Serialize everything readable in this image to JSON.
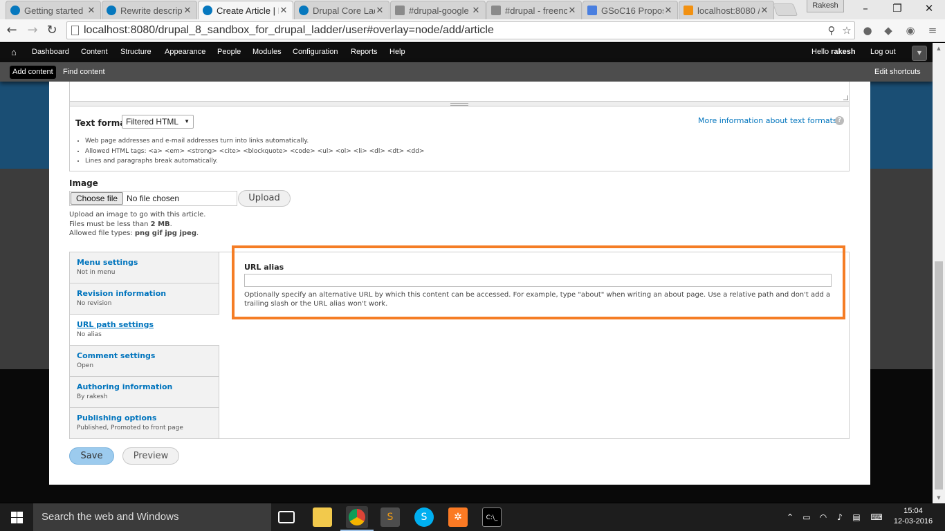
{
  "browser": {
    "tabs": [
      {
        "title": "Getting started",
        "favicon": "drupal-drop-icon"
      },
      {
        "title": "Rewrite descript",
        "favicon": "drupal-drop-icon"
      },
      {
        "title": "Create Article | I",
        "favicon": "drupal-drop-icon",
        "active": true
      },
      {
        "title": "Drupal Core Lad",
        "favicon": "drupal-drop-icon"
      },
      {
        "title": "#drupal-google",
        "favicon": "irc-icon"
      },
      {
        "title": "#drupal - freenc",
        "favicon": "irc-icon"
      },
      {
        "title": "GSoC16 Propos",
        "favicon": "google-docs-icon"
      },
      {
        "title": "localhost:8080 /",
        "favicon": "phpmyadmin-icon"
      }
    ],
    "profile_name": "Rakesh",
    "url": "localhost:8080/drupal_8_sandbox_for_drupal_ladder/user#overlay=node/add/article"
  },
  "admin_toolbar": {
    "menu": [
      "Dashboard",
      "Content",
      "Structure",
      "Appearance",
      "People",
      "Modules",
      "Configuration",
      "Reports",
      "Help"
    ],
    "greeting": "Hello ",
    "username": "rakesh",
    "logout": "Log out",
    "shortcuts": {
      "add_content": "Add content",
      "find_content": "Find content",
      "edit_shortcuts": "Edit shortcuts"
    }
  },
  "text_format": {
    "label": "Text format",
    "selected": "Filtered HTML",
    "more_info": "More information about text formats",
    "help_icon": "?",
    "tips": [
      "Web page addresses and e-mail addresses turn into links automatically.",
      "Allowed HTML tags: <a> <em> <strong> <cite> <blockquote> <code> <ul> <ol> <li> <dl> <dt> <dd>",
      "Lines and paragraphs break automatically."
    ]
  },
  "image_field": {
    "label": "Image",
    "choose_file": "Choose file",
    "no_file": "No file chosen",
    "upload": "Upload",
    "help_line1": "Upload an image to go with this article.",
    "help_size_prefix": "Files must be less than ",
    "help_size_value": "2 MB",
    "help_size_suffix": ".",
    "help_types_prefix": "Allowed file types: ",
    "help_types_value": "png gif jpg jpeg",
    "help_types_suffix": "."
  },
  "vertical_tabs": [
    {
      "title": "Menu settings",
      "summary": "Not in menu"
    },
    {
      "title": "Revision information",
      "summary": "No revision"
    },
    {
      "title": "URL path settings",
      "summary": "No alias",
      "selected": true
    },
    {
      "title": "Comment settings",
      "summary": "Open"
    },
    {
      "title": "Authoring information",
      "summary": "By rakesh"
    },
    {
      "title": "Publishing options",
      "summary": "Published, Promoted to front page"
    }
  ],
  "url_alias": {
    "label": "URL alias",
    "value": "",
    "description": "Optionally specify an alternative URL by which this content can be accessed. For example, type \"about\" when writing an about page. Use a relative path and don't add a trailing slash or the URL alias won't work."
  },
  "actions": {
    "save": "Save",
    "preview": "Preview"
  },
  "taskbar": {
    "search_placeholder": "Search the web and Windows",
    "time": "15:04",
    "date": "12-03-2016"
  },
  "colors": {
    "highlight": "#f57d25",
    "drupal_link": "#0074bd",
    "admin_bar": "#0f0f0f"
  }
}
